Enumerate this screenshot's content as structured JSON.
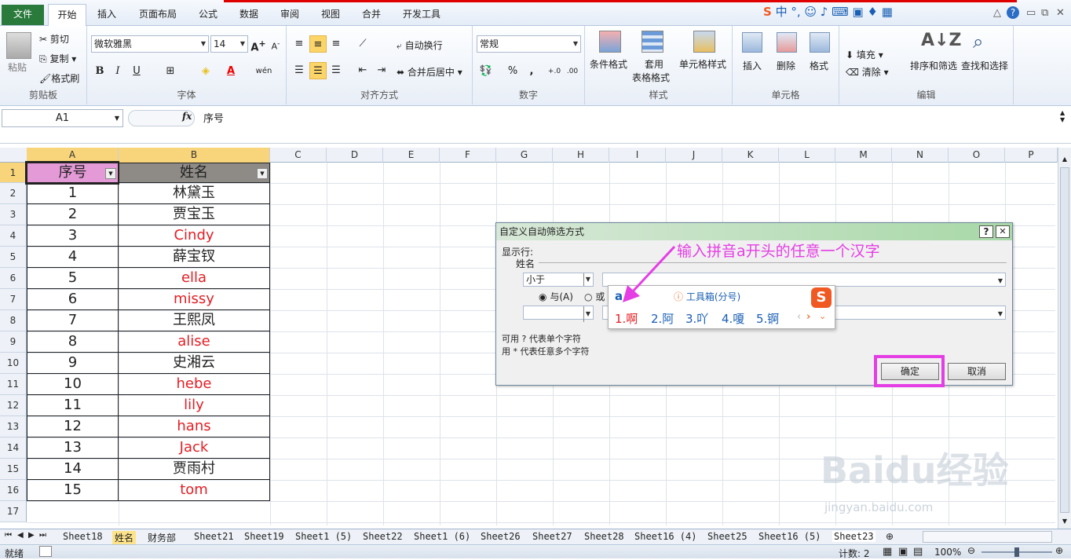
{
  "ribbon_tabs": [
    "文件",
    "开始",
    "插入",
    "页面布局",
    "公式",
    "数据",
    "审阅",
    "视图",
    "合并",
    "开发工具"
  ],
  "clipboard": {
    "paste": "粘贴",
    "cut": "剪切",
    "copy": "复制",
    "format_painter": "格式刷",
    "label": "剪贴板"
  },
  "font": {
    "name": "微软雅黑",
    "size": "14",
    "label": "字体"
  },
  "align": {
    "wrap": "自动换行",
    "merge": "合并后居中",
    "label": "对齐方式"
  },
  "number": {
    "format": "常规",
    "label": "数字"
  },
  "styles": {
    "cond": "条件格式",
    "table1": "套用",
    "table2": "表格格式",
    "cell": "单元格样式",
    "label": "样式"
  },
  "cells": {
    "insert": "插入",
    "delete": "删除",
    "format": "格式",
    "label": "单元格"
  },
  "editing": {
    "fill": "填充",
    "clear": "清除",
    "sort": "排序和筛选",
    "find": "查找和选择",
    "label": "编辑"
  },
  "formula_bar": {
    "name_box": "A1",
    "fx": "fx",
    "content": "序号"
  },
  "columns": [
    "A",
    "B",
    "C",
    "D",
    "E",
    "F",
    "G",
    "H",
    "I",
    "J",
    "K",
    "L",
    "M",
    "N",
    "O",
    "P"
  ],
  "header_row": {
    "a": "序号",
    "b": "姓名"
  },
  "rows": [
    {
      "n": "2",
      "a": "1",
      "b": "林黛玉",
      "red": false
    },
    {
      "n": "3",
      "a": "2",
      "b": "贾宝玉",
      "red": false
    },
    {
      "n": "4",
      "a": "3",
      "b": "Cindy",
      "red": true
    },
    {
      "n": "5",
      "a": "4",
      "b": "薛宝钗",
      "red": false
    },
    {
      "n": "6",
      "a": "5",
      "b": "ella",
      "red": true
    },
    {
      "n": "7",
      "a": "6",
      "b": "missy",
      "red": true
    },
    {
      "n": "8",
      "a": "7",
      "b": "王熙凤",
      "red": false
    },
    {
      "n": "9",
      "a": "8",
      "b": "alise",
      "red": true
    },
    {
      "n": "10",
      "a": "9",
      "b": "史湘云",
      "red": false
    },
    {
      "n": "11",
      "a": "10",
      "b": "hebe",
      "red": true
    },
    {
      "n": "12",
      "a": "11",
      "b": "lily",
      "red": true
    },
    {
      "n": "13",
      "a": "12",
      "b": "hans",
      "red": true
    },
    {
      "n": "14",
      "a": "13",
      "b": "Jack",
      "red": true
    },
    {
      "n": "15",
      "a": "14",
      "b": "贾雨村",
      "red": false
    },
    {
      "n": "16",
      "a": "15",
      "b": "tom",
      "red": true
    }
  ],
  "row_numbers": [
    "1",
    "17"
  ],
  "dialog": {
    "title": "自定义自动筛选方式",
    "help": "?",
    "close": "✕",
    "show_rows": "显示行:",
    "field": "姓名",
    "op1": "小于",
    "and_label": "与(A)",
    "or_label": "或",
    "hint1": "可用 ? 代表单个字符",
    "hint2": "用 * 代表任意多个字符",
    "ok": "确定",
    "cancel": "取消"
  },
  "ime": {
    "typed": "a",
    "toolbox": "工具箱(分号)",
    "candidates": [
      "1.啊",
      "2.阿",
      "3.吖",
      "4.嗄",
      "5.锕"
    ]
  },
  "annotation": "输入拼音a开头的任意一个汉字",
  "sheets": [
    "Sheet18",
    "姓名",
    "财务部",
    "Sheet21",
    "Sheet19",
    "Sheet1 (5)",
    "Sheet22",
    "Sheet1 (6)",
    "Sheet26",
    "Sheet27",
    "Sheet28",
    "Sheet16 (4)",
    "Sheet25",
    "Sheet16 (5)",
    "Sheet23"
  ],
  "status": {
    "ready": "就绪",
    "count": "计数: 2",
    "zoom": "100%"
  },
  "watermark": {
    "main": "Baidu经验",
    "sub": "jingyan.baidu.com"
  },
  "colors": {
    "file_tab": "#2a7a3c",
    "header_a": "#e39ad6",
    "header_b": "#8e8a86",
    "highlight": "#e43ee4"
  }
}
